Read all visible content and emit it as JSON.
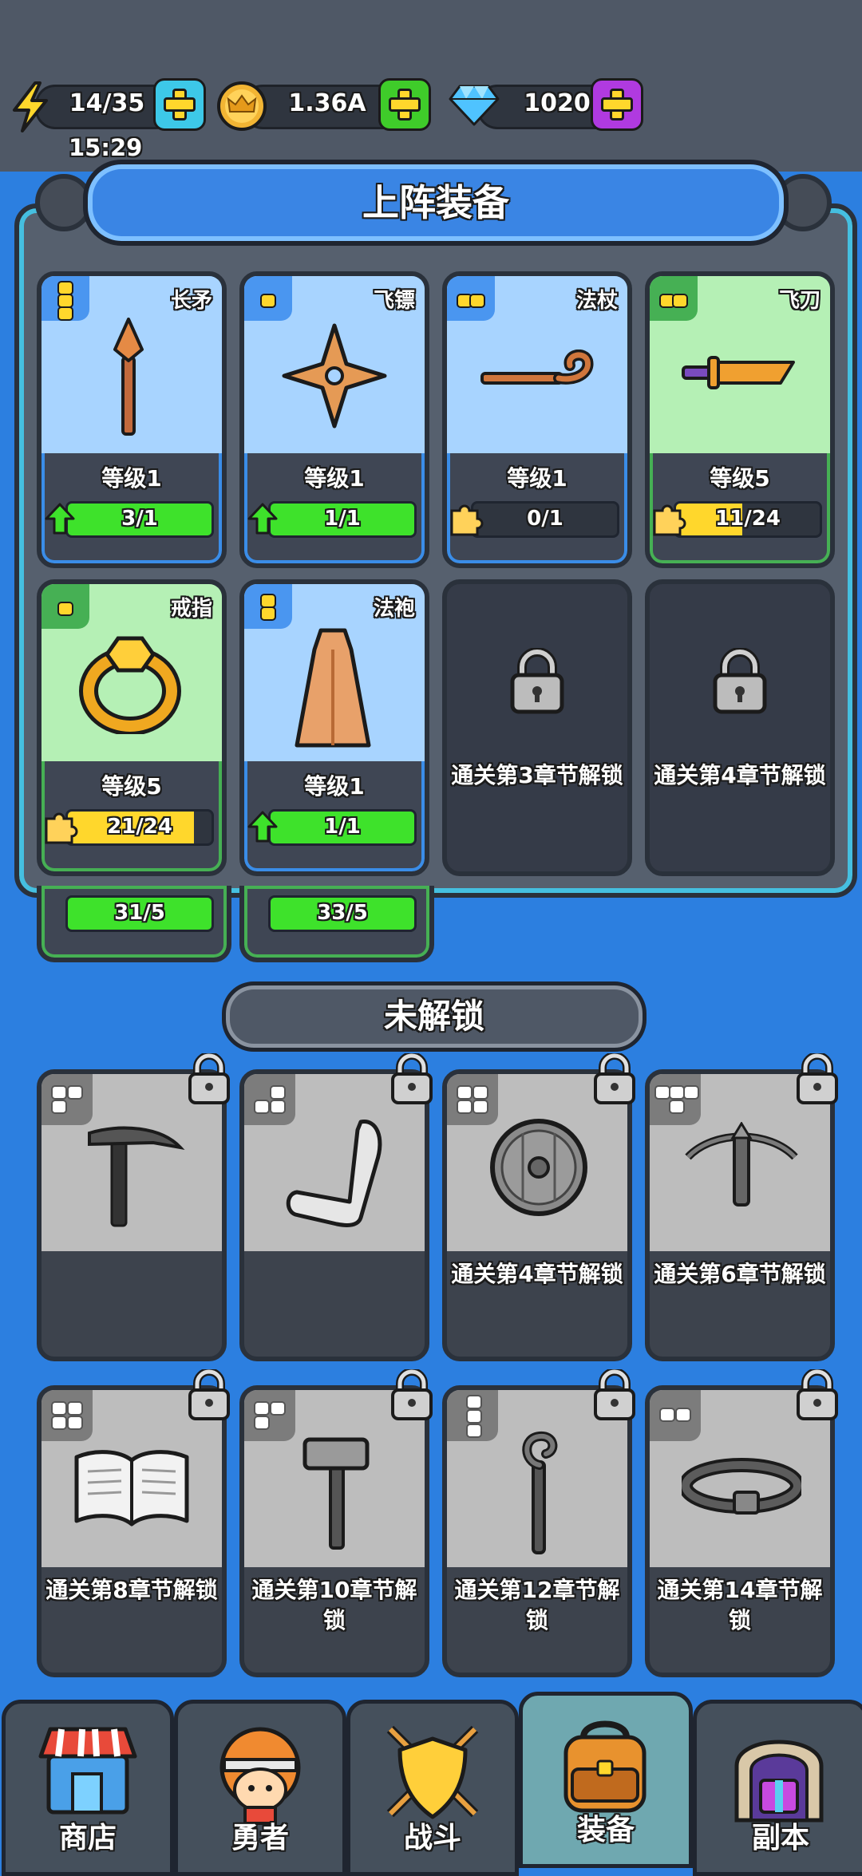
{
  "resources": {
    "energy": {
      "value": "14/35",
      "icon": "lightning-icon",
      "timer": "15:29"
    },
    "coins": {
      "value": "1.36A",
      "icon": "crown-coin-icon"
    },
    "gems": {
      "value": "1020",
      "icon": "diamond-icon"
    }
  },
  "equipped": {
    "title": "上阵装备",
    "items": [
      {
        "name": "长矛",
        "level": "等级1",
        "progress": "3/1",
        "ratio": 1.0,
        "kind": "upgrade",
        "rarity": "blue",
        "dots": 3
      },
      {
        "name": "飞镖",
        "level": "等级1",
        "progress": "1/1",
        "ratio": 1.0,
        "kind": "upgrade",
        "rarity": "blue",
        "dots": 1
      },
      {
        "name": "法杖",
        "level": "等级1",
        "progress": "0/1",
        "ratio": 0.0,
        "kind": "puzzle",
        "rarity": "blue",
        "dots": 2
      },
      {
        "name": "飞刀",
        "level": "等级5",
        "progress": "11/24",
        "ratio": 0.46,
        "kind": "puzzle",
        "rarity": "green",
        "dots": 2
      },
      {
        "name": "戒指",
        "level": "等级5",
        "progress": "21/24",
        "ratio": 0.875,
        "kind": "puzzle",
        "rarity": "green",
        "dots": 1
      },
      {
        "name": "法袍",
        "level": "等级1",
        "progress": "1/1",
        "ratio": 1.0,
        "kind": "upgrade",
        "rarity": "blue",
        "dots": 2
      }
    ],
    "locked_slots": [
      "通关第3章节解锁",
      "通关第4章节解锁"
    ],
    "peek_bars": [
      "31/5",
      "33/5"
    ]
  },
  "unlock_section": {
    "title": "未解锁",
    "items": [
      {
        "icon": "pickaxe-icon",
        "msg": ""
      },
      {
        "icon": "boomerang-icon",
        "msg": ""
      },
      {
        "icon": "shield-icon",
        "msg": "通关第4章节解锁"
      },
      {
        "icon": "crossbow-icon",
        "msg": "通关第6章节解锁"
      },
      {
        "icon": "book-icon",
        "msg": "通关第8章节解锁"
      },
      {
        "icon": "hammer-icon",
        "msg": "通关第10章节解锁"
      },
      {
        "icon": "staff-icon",
        "msg": "通关第12章节解锁"
      },
      {
        "icon": "belt-icon",
        "msg": "通关第14章节解锁"
      }
    ]
  },
  "nav": {
    "tabs": [
      {
        "label": "商店",
        "icon": "shop-icon"
      },
      {
        "label": "勇者",
        "icon": "hero-icon"
      },
      {
        "label": "战斗",
        "icon": "battle-shield-icon"
      },
      {
        "label": "装备",
        "icon": "backpack-icon",
        "active": true
      },
      {
        "label": "副本",
        "icon": "dungeon-gate-icon"
      }
    ]
  },
  "colors": {
    "blue_card": "#a8d4ff",
    "green_card": "#b5f0b5",
    "progress_green": "#3ee22b",
    "progress_yellow": "#ffd72c",
    "background": "#2c7fe0"
  }
}
